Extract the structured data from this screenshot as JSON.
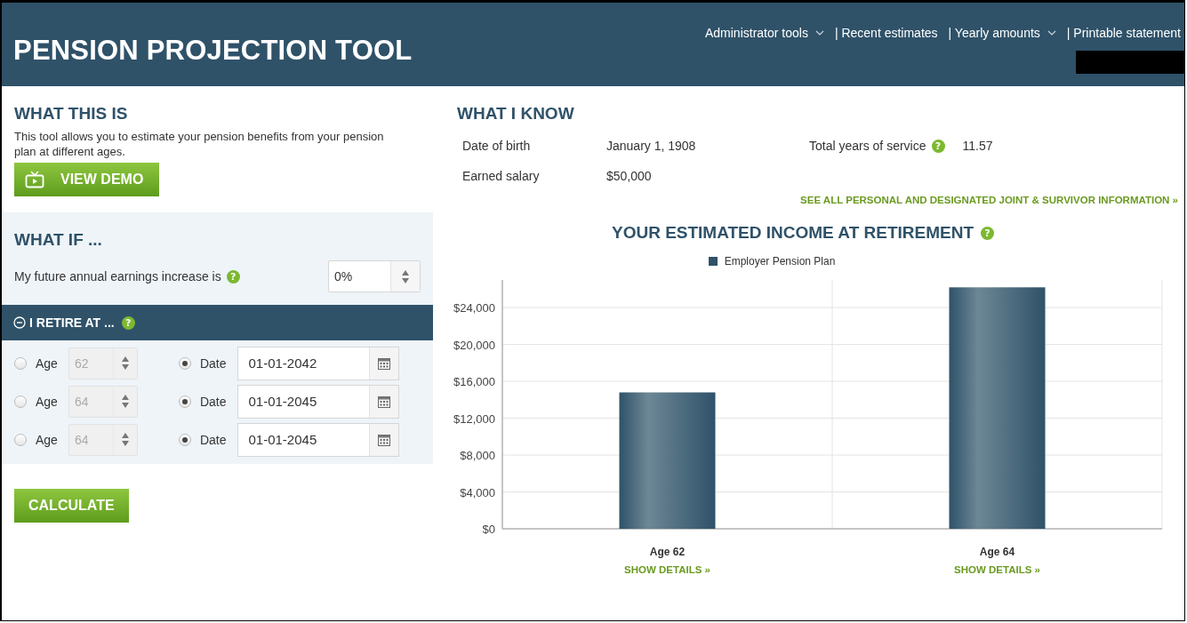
{
  "header": {
    "title": "PENSION PROJECTION TOOL",
    "nav": [
      {
        "label": "Administrator tools",
        "dropdown": true
      },
      {
        "label": "| Recent estimates",
        "dropdown": false
      },
      {
        "label": "| Yearly amounts",
        "dropdown": true
      },
      {
        "label": "| Printable statement",
        "dropdown": false
      }
    ]
  },
  "what_this_is": {
    "heading": "WHAT THIS IS",
    "text": "This tool allows you to estimate your pension benefits from your pension plan at different ages.",
    "button": "VIEW DEMO"
  },
  "what_if": {
    "heading": "WHAT IF ...",
    "earnings_label": "My future annual earnings increase is",
    "help": "?",
    "earnings_value": "0%"
  },
  "retire": {
    "heading": "I RETIRE AT ...",
    "help": "?",
    "expanded": true,
    "rows": [
      {
        "age_label": "Age",
        "age_value": "62",
        "age_selected": false,
        "date_label": "Date",
        "date_value": "01-01-2042",
        "date_selected": true
      },
      {
        "age_label": "Age",
        "age_value": "64",
        "age_selected": false,
        "date_label": "Date",
        "date_value": "01-01-2045",
        "date_selected": true
      },
      {
        "age_label": "Age",
        "age_value": "64",
        "age_selected": false,
        "date_label": "Date",
        "date_value": "01-01-2045",
        "date_selected": true
      }
    ],
    "button": "CALCULATE"
  },
  "what_i_know": {
    "heading": "WHAT I KNOW",
    "facts": [
      {
        "label": "Date of birth",
        "value": "January 1, 1908"
      },
      {
        "label": "Earned salary",
        "value": "$50,000"
      }
    ],
    "service": {
      "label": "Total years of service",
      "help": "?",
      "value": "11.57"
    },
    "link": "SEE ALL PERSONAL AND DESIGNATED JOINT & SURVIVOR INFORMATION »"
  },
  "income": {
    "heading": "YOUR ESTIMATED INCOME AT RETIREMENT",
    "help": "?",
    "chart_data": {
      "type": "bar",
      "grid": true,
      "categories": [
        "Age 62",
        "Age 64"
      ],
      "series": [
        {
          "name": "Employer Pension Plan",
          "color": "#2f5269",
          "values": [
            14800,
            26200
          ]
        }
      ],
      "ylim": [
        0,
        27000
      ],
      "yticks": [
        {
          "value": 0,
          "label": "$0"
        },
        {
          "value": 4000,
          "label": "$4,000"
        },
        {
          "value": 8000,
          "label": "$8,000"
        },
        {
          "value": 12000,
          "label": "$12,000"
        },
        {
          "value": 16000,
          "label": "$16,000"
        },
        {
          "value": 20000,
          "label": "$20,000"
        },
        {
          "value": 24000,
          "label": "$24,000"
        }
      ]
    },
    "details_links": [
      "SHOW DETAILS »",
      "SHOW DETAILS »"
    ]
  }
}
